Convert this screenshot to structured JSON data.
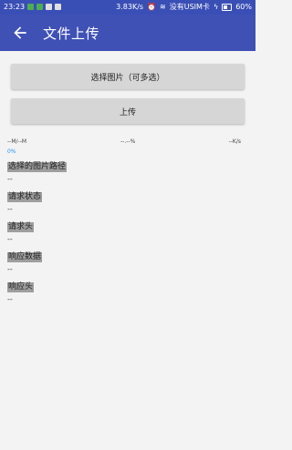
{
  "status_bar": {
    "time": "23:23",
    "network_speed": "3.83K/s",
    "carrier": "没有USIM卡",
    "battery": "60%",
    "battery_level": 0.6
  },
  "app_bar": {
    "title": "文件上传"
  },
  "buttons": {
    "pick_images": "选择图片（可多选）",
    "upload": "上传"
  },
  "progress": {
    "size": "--M/--M",
    "percent_text": "--.--%",
    "speed": "--K/s",
    "progress_label": "0%",
    "progress_value": 0
  },
  "sections": {
    "selected_paths": {
      "label": "选择的图片路径",
      "value": "--"
    },
    "request_status": {
      "label": "请求状态",
      "value": "--"
    },
    "request_headers": {
      "label": "请求头",
      "value": "--"
    },
    "response_data": {
      "label": "响应数据",
      "value": "--"
    },
    "response_headers": {
      "label": "响应头",
      "value": "--"
    }
  },
  "colors": {
    "app_bar": "#3f51b5",
    "status_bar": "#3a4fb5",
    "progress_accent": "#2196f3"
  }
}
